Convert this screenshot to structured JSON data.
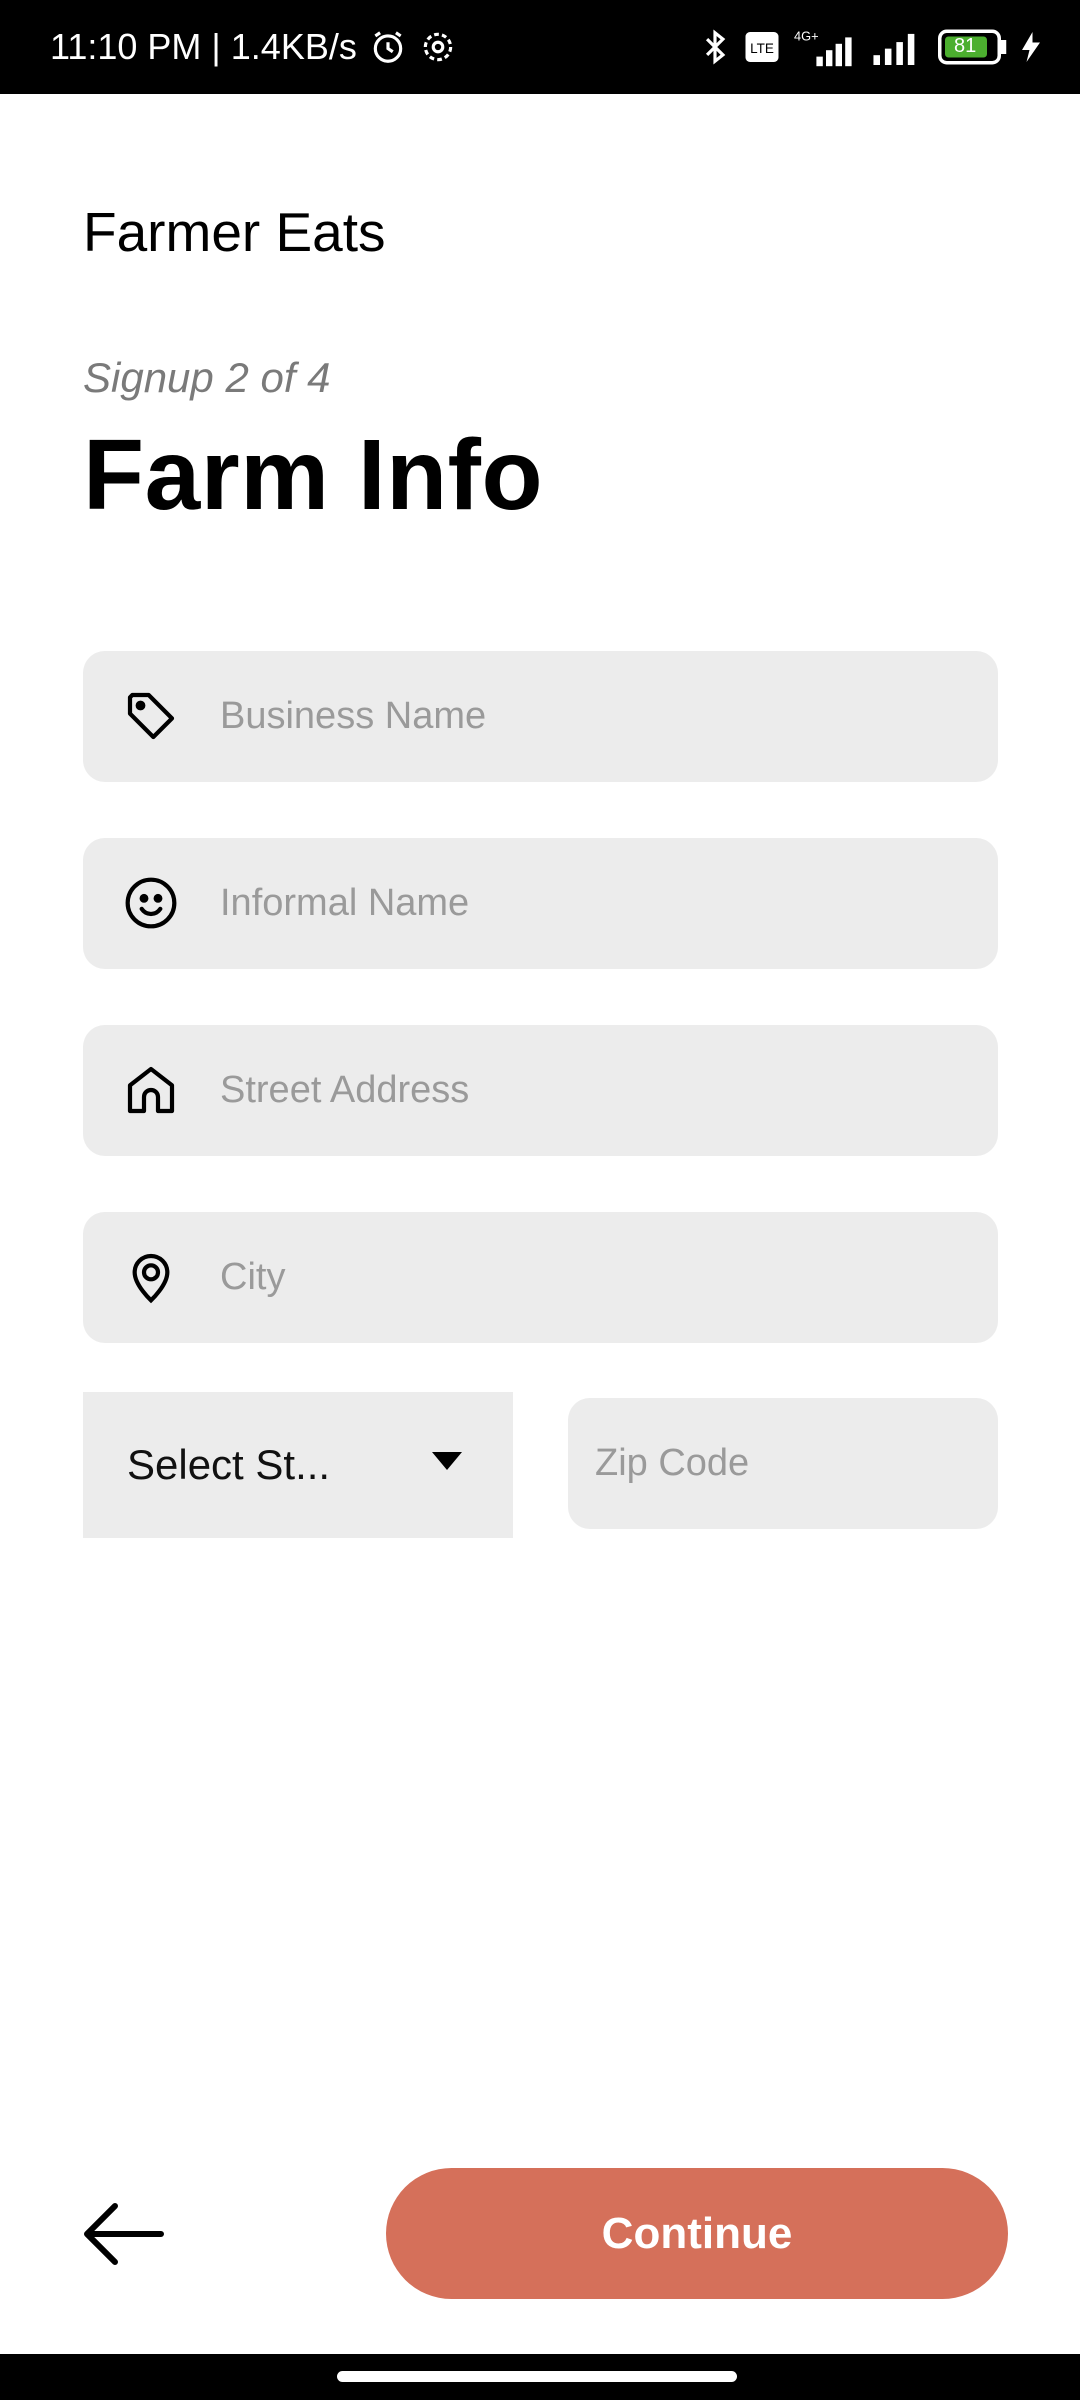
{
  "status_bar": {
    "time_speed": "11:10 PM | 1.4KB/s",
    "battery": "81",
    "icons": [
      "alarm-icon",
      "settings-icon",
      "bluetooth-icon",
      "volte-icon",
      "signal-4g-icon",
      "signal-icon",
      "battery-icon",
      "charging-icon"
    ]
  },
  "app": {
    "name": "Farmer Eats"
  },
  "header": {
    "step": "Signup 2 of 4",
    "title": "Farm Info"
  },
  "form": {
    "business_name": {
      "placeholder": "Business Name",
      "value": "",
      "icon": "tag-icon"
    },
    "informal_name": {
      "placeholder": "Informal Name",
      "value": "",
      "icon": "smiley-icon"
    },
    "street_address": {
      "placeholder": "Street Address",
      "value": "",
      "icon": "home-icon"
    },
    "city": {
      "placeholder": "City",
      "value": "",
      "icon": "location-pin-icon"
    },
    "state": {
      "label": "Select St..."
    },
    "zip": {
      "placeholder": "Zip Code",
      "value": ""
    }
  },
  "footer": {
    "continue_label": "Continue",
    "back_icon": "arrow-left-icon"
  },
  "colors": {
    "accent": "#d5705a",
    "field_bg": "#ececec",
    "placeholder": "#9a9a9a"
  }
}
